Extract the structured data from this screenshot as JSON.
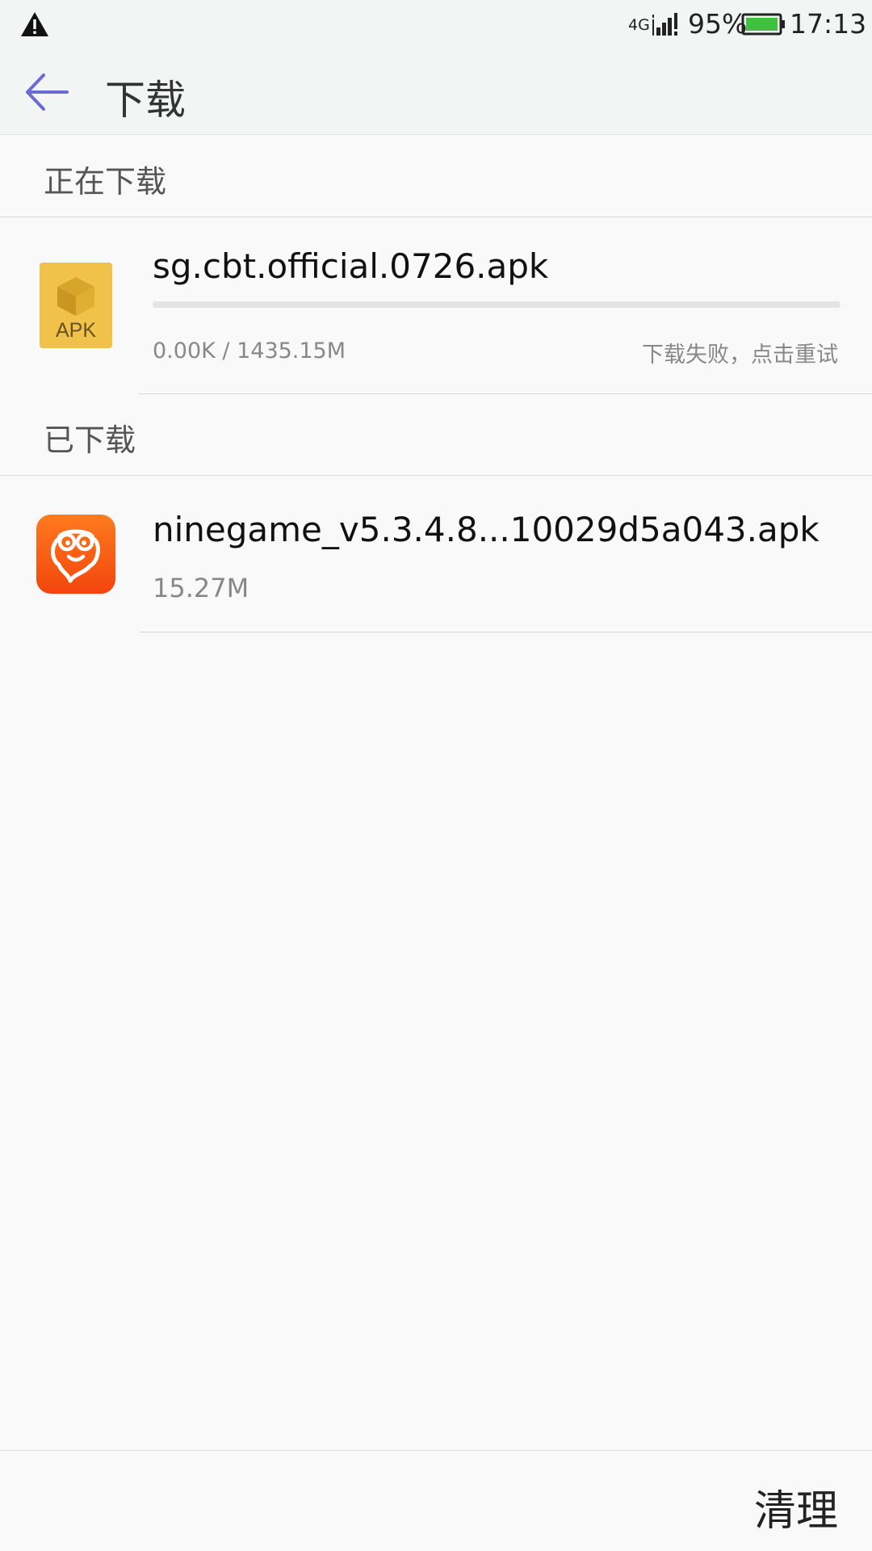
{
  "status_bar": {
    "warning_icon": "warning-triangle-icon",
    "network": "4G",
    "signal_icon": "signal-bars-icon",
    "battery_percent": "95%",
    "battery_icon": "battery-icon",
    "battery_color": "#3ec23e",
    "time": "17:13"
  },
  "app_bar": {
    "back_icon": "back-arrow-icon",
    "back_color": "#6b6bd6",
    "title": "下载"
  },
  "downloading": {
    "header": "正在下载",
    "items": [
      {
        "icon": "apk-file-icon",
        "icon_label": "APK",
        "file_name": "sg.cbt.official.0726.apk",
        "size_progress": "0.00K / 1435.15M",
        "status": "下载失败，点击重试",
        "progress": 0
      }
    ]
  },
  "downloaded": {
    "header": "已下载",
    "items": [
      {
        "icon": "ninegame-app-icon",
        "file_name": "ninegame_v5.3.4.8...10029d5a043.apk",
        "size": "15.27M"
      }
    ]
  },
  "bottom_bar": {
    "clean_label": "清理"
  }
}
